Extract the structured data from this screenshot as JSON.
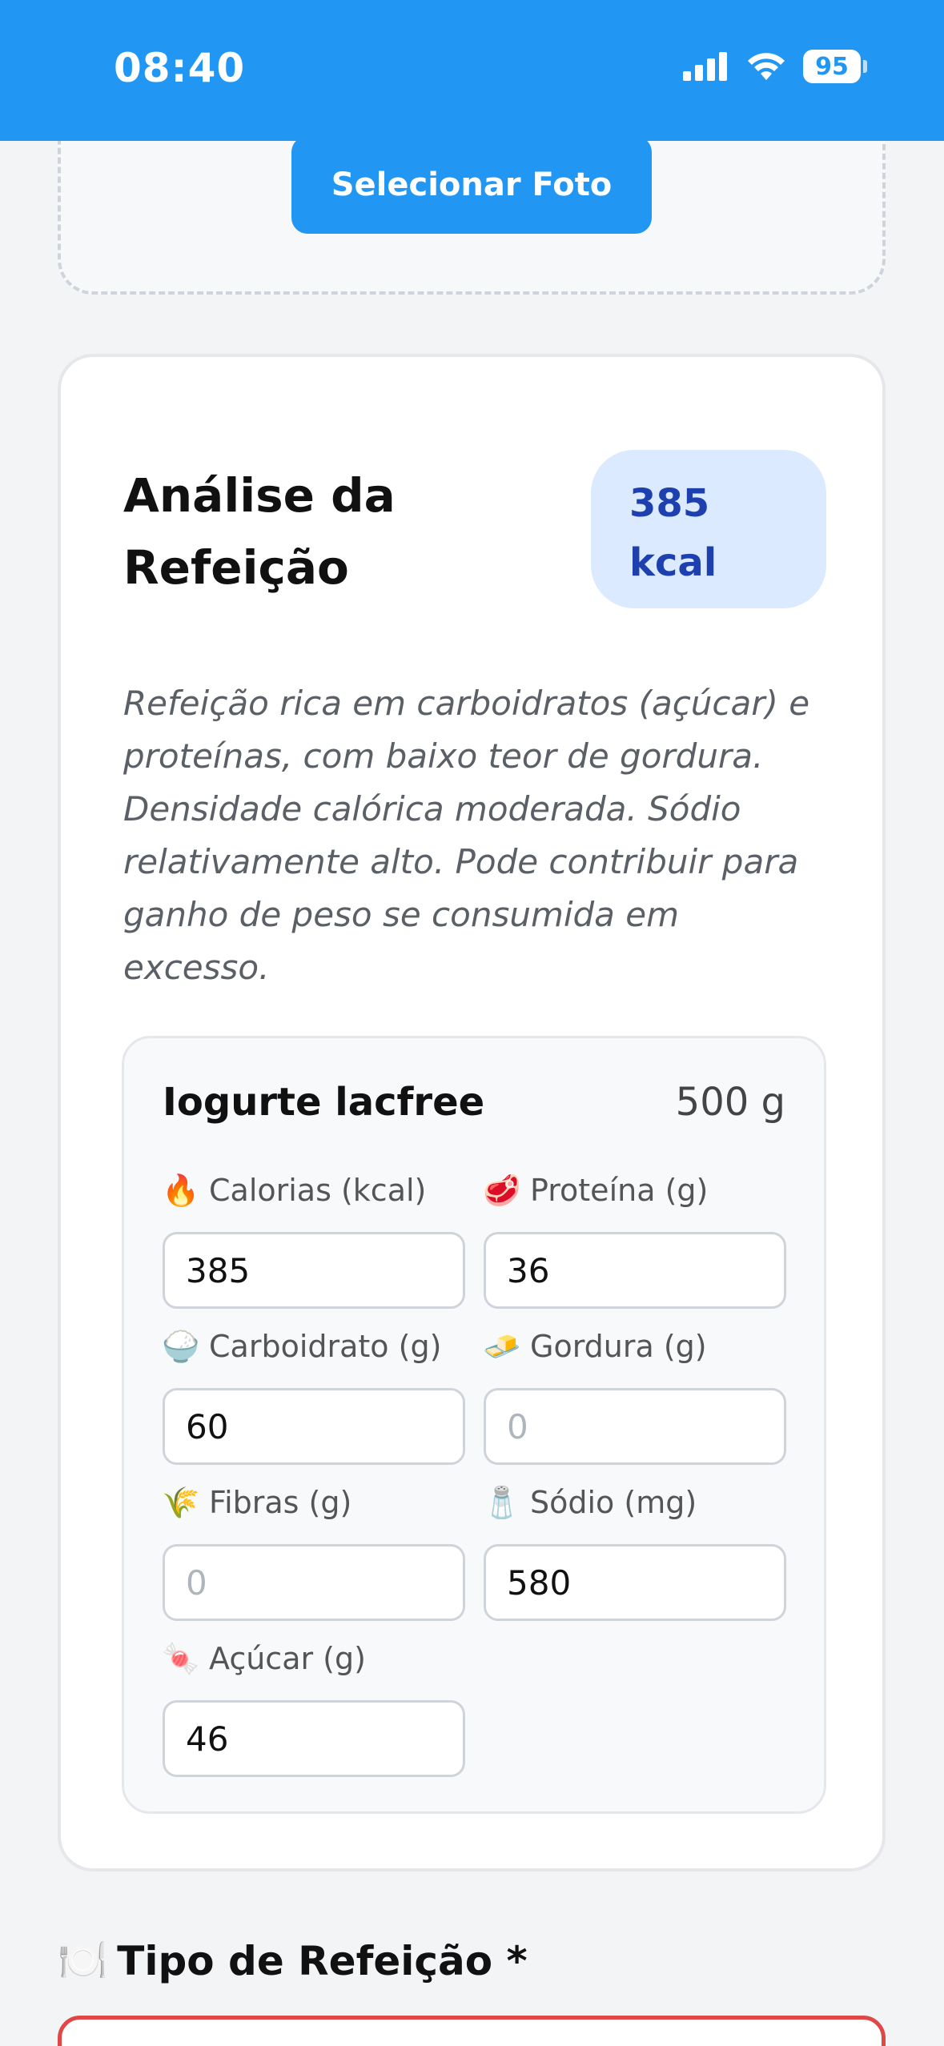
{
  "status_bar": {
    "time": "08:40",
    "battery": "95"
  },
  "upload": {
    "button_label": "Selecionar Foto"
  },
  "analysis": {
    "title": "Análise da Refeição",
    "kcal_value": "385",
    "kcal_unit": "kcal",
    "description": "Refeição rica em carboidratos (açúcar) e proteínas, com baixo teor de gordura. Densidade calórica moderada. Sódio relativamente alto. Pode contribuir para ganho de peso se consumida em excesso."
  },
  "food_item": {
    "name": "Iogurte lacfree",
    "weight": "500 g",
    "fields": {
      "calories": {
        "emoji": "🔥",
        "label": "Calorias (kcal)",
        "value": "385",
        "placeholder": "0"
      },
      "protein": {
        "emoji": "🥩",
        "label": "Proteína (g)",
        "value": "36",
        "placeholder": "0"
      },
      "carbs": {
        "emoji": "🍚",
        "label": "Carboidrato (g)",
        "value": "60",
        "placeholder": "0"
      },
      "fat": {
        "emoji": "🧈",
        "label": "Gordura (g)",
        "value": "",
        "placeholder": "0"
      },
      "fiber": {
        "emoji": "🌾",
        "label": "Fibras (g)",
        "value": "",
        "placeholder": "0"
      },
      "sodium": {
        "emoji": "🧂",
        "label": "Sódio (mg)",
        "value": "580",
        "placeholder": "0"
      },
      "sugar": {
        "emoji": "🍬",
        "label": "Açúcar (g)",
        "value": "46",
        "placeholder": "0"
      }
    }
  },
  "meal_type": {
    "emoji": "🍽️",
    "label": "Tipo de Refeição *"
  },
  "colors": {
    "primary": "#2196f3",
    "badge_bg": "#dbeafe",
    "badge_text": "#1e40af",
    "error_border": "#e04848"
  }
}
